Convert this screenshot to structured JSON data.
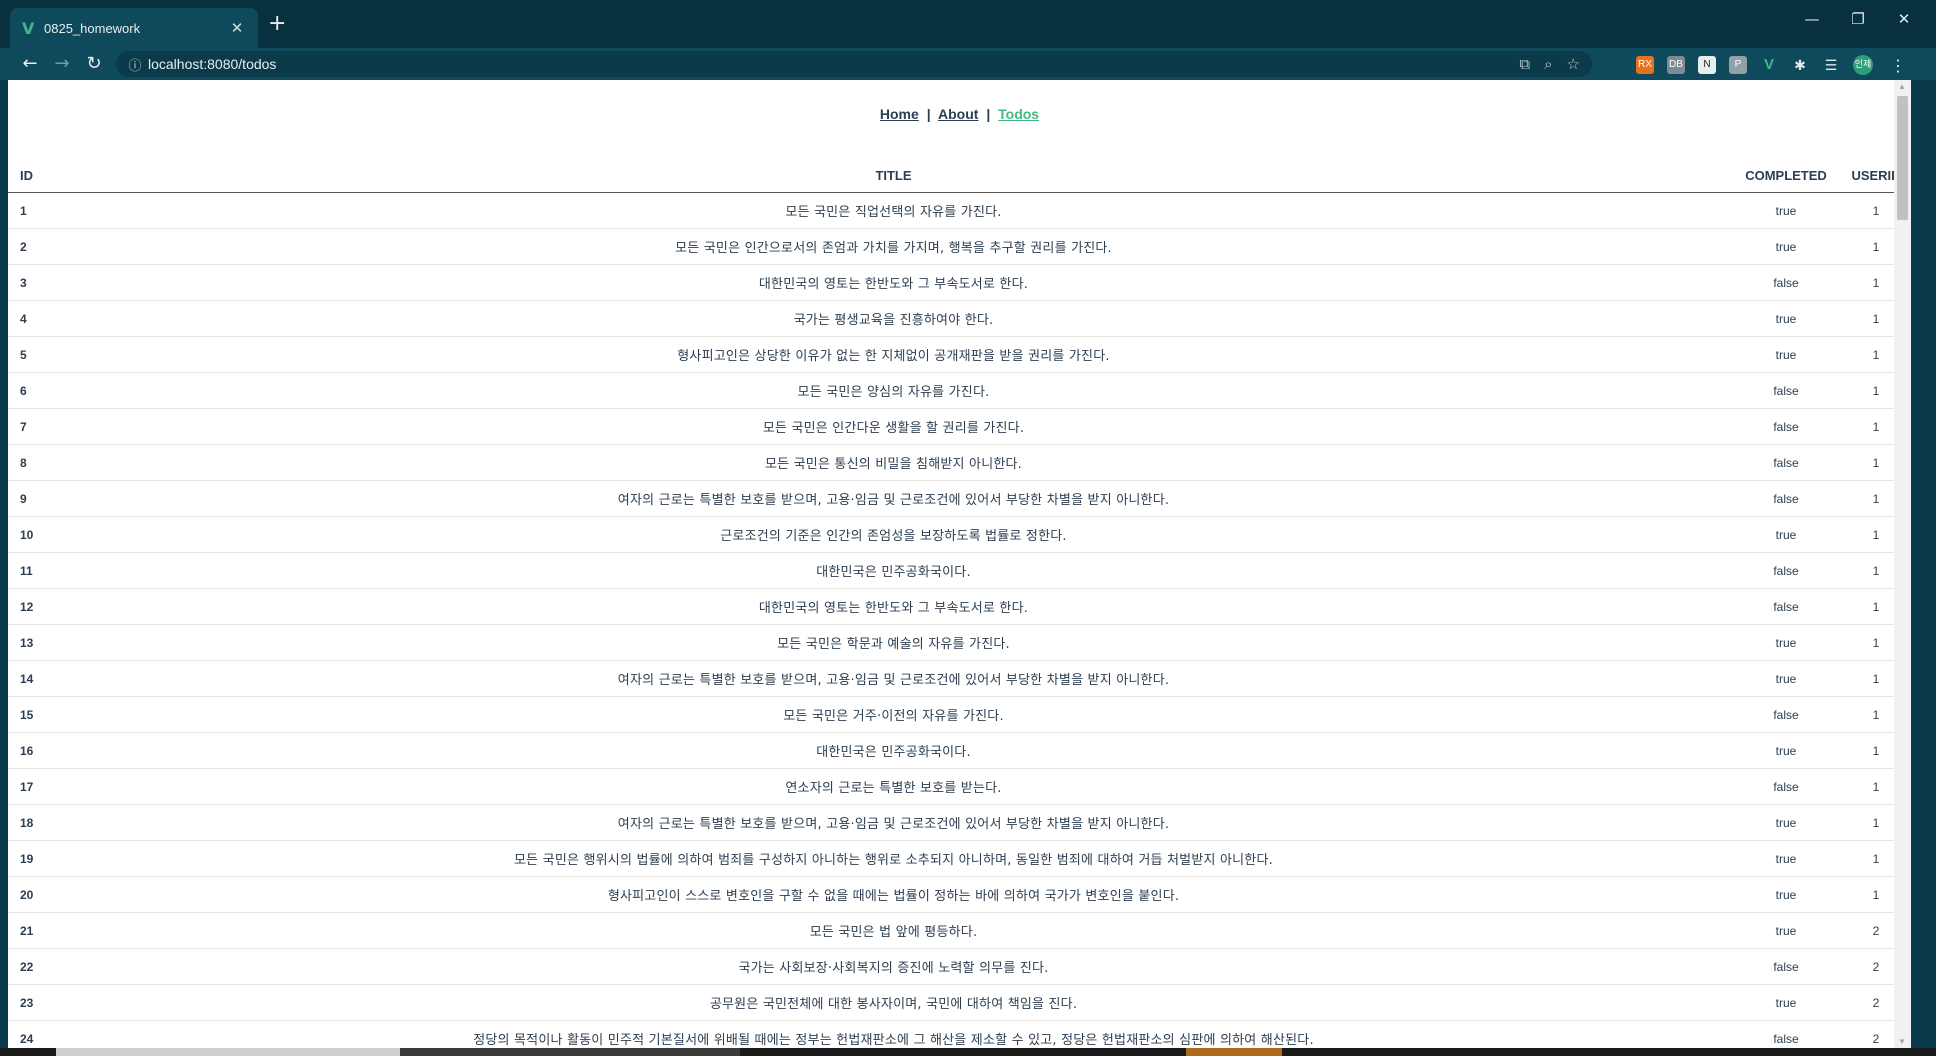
{
  "browser": {
    "tab_favicon": "V",
    "tab_title": "0825_homework",
    "tab_close": "✕",
    "new_tab": "+",
    "url": "localhost:8080/todos",
    "minimize": "—",
    "restore": "❐",
    "close": "✕"
  },
  "extensions": [
    "RX",
    "DB",
    "N",
    "P",
    "V",
    "puzzle",
    "list",
    "인제"
  ],
  "nav": {
    "home": "Home",
    "about": "About",
    "todos": "Todos",
    "sep": "|"
  },
  "table": {
    "headers": {
      "id": "ID",
      "title": "TITLE",
      "completed": "COMPLETED",
      "userid": "USERID"
    },
    "rows": [
      {
        "id": "1",
        "title": "모든 국민은 직업선택의 자유를 가진다.",
        "completed": "true",
        "userid": "1"
      },
      {
        "id": "2",
        "title": "모든 국민은 인간으로서의 존엄과 가치를 가지며, 행복을 추구할 권리를 가진다.",
        "completed": "true",
        "userid": "1"
      },
      {
        "id": "3",
        "title": "대한민국의 영토는 한반도와 그 부속도서로 한다.",
        "completed": "false",
        "userid": "1"
      },
      {
        "id": "4",
        "title": "국가는 평생교육을 진흥하여야 한다.",
        "completed": "true",
        "userid": "1"
      },
      {
        "id": "5",
        "title": "형사피고인은 상당한 이유가 없는 한 지체없이 공개재판을 받을 권리를 가진다.",
        "completed": "true",
        "userid": "1"
      },
      {
        "id": "6",
        "title": "모든 국민은 양심의 자유를 가진다.",
        "completed": "false",
        "userid": "1"
      },
      {
        "id": "7",
        "title": "모든 국민은 인간다운 생활을 할 권리를 가진다.",
        "completed": "false",
        "userid": "1"
      },
      {
        "id": "8",
        "title": "모든 국민은 통신의 비밀을 침해받지 아니한다.",
        "completed": "false",
        "userid": "1"
      },
      {
        "id": "9",
        "title": "여자의 근로는 특별한 보호를 받으며, 고용·임금 및 근로조건에 있어서 부당한 차별을 받지 아니한다.",
        "completed": "false",
        "userid": "1"
      },
      {
        "id": "10",
        "title": "근로조건의 기준은 인간의 존엄성을 보장하도록 법률로 정한다.",
        "completed": "true",
        "userid": "1"
      },
      {
        "id": "11",
        "title": "대한민국은 민주공화국이다.",
        "completed": "false",
        "userid": "1"
      },
      {
        "id": "12",
        "title": "대한민국의 영토는 한반도와 그 부속도서로 한다.",
        "completed": "false",
        "userid": "1"
      },
      {
        "id": "13",
        "title": "모든 국민은 학문과 예술의 자유를 가진다.",
        "completed": "true",
        "userid": "1"
      },
      {
        "id": "14",
        "title": "여자의 근로는 특별한 보호를 받으며, 고용·임금 및 근로조건에 있어서 부당한 차별을 받지 아니한다.",
        "completed": "true",
        "userid": "1"
      },
      {
        "id": "15",
        "title": "모든 국민은 거주·이전의 자유를 가진다.",
        "completed": "false",
        "userid": "1"
      },
      {
        "id": "16",
        "title": "대한민국은 민주공화국이다.",
        "completed": "true",
        "userid": "1"
      },
      {
        "id": "17",
        "title": "연소자의 근로는 특별한 보호를 받는다.",
        "completed": "false",
        "userid": "1"
      },
      {
        "id": "18",
        "title": "여자의 근로는 특별한 보호를 받으며, 고용·임금 및 근로조건에 있어서 부당한 차별을 받지 아니한다.",
        "completed": "true",
        "userid": "1"
      },
      {
        "id": "19",
        "title": "모든 국민은 행위시의 법률에 의하여 범죄를 구성하지 아니하는 행위로 소추되지 아니하며, 동일한 범죄에 대하여 거듭 처벌받지 아니한다.",
        "completed": "true",
        "userid": "1"
      },
      {
        "id": "20",
        "title": "형사피고인이 스스로 변호인을 구할 수 없을 때에는 법률이 정하는 바에 의하여 국가가 변호인을 붙인다.",
        "completed": "true",
        "userid": "1"
      },
      {
        "id": "21",
        "title": "모든 국민은 법 앞에 평등하다.",
        "completed": "true",
        "userid": "2"
      },
      {
        "id": "22",
        "title": "국가는 사회보장·사회복지의 증진에 노력할 의무를 진다.",
        "completed": "false",
        "userid": "2"
      },
      {
        "id": "23",
        "title": "공무원은 국민전체에 대한 봉사자이며, 국민에 대하여 책임을 진다.",
        "completed": "true",
        "userid": "2"
      },
      {
        "id": "24",
        "title": "정당의 목적이나 활동이 민주적 기본질서에 위배될 때에는 정부는 헌법재판소에 그 해산을 제소할 수 있고, 정당은 헌법재판소의 심판에 의하여 해산된다.",
        "completed": "false",
        "userid": "2"
      }
    ]
  }
}
